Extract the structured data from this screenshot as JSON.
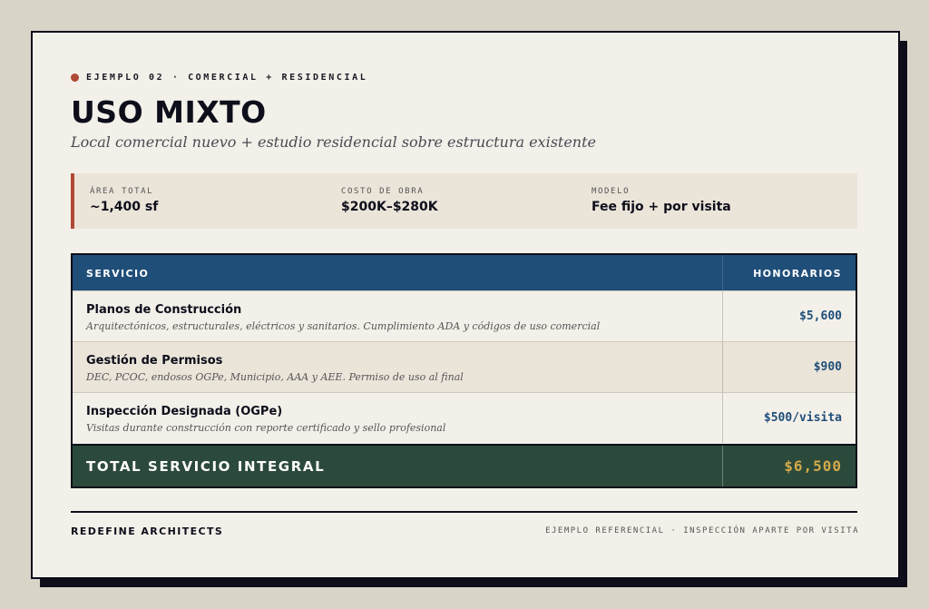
{
  "eyebrow": "EJEMPLO 02 · COMERCIAL + RESIDENCIAL",
  "title": "USO MIXTO",
  "subtitle": "Local comercial nuevo + estudio residencial sobre estructura existente",
  "stats": [
    {
      "label": "ÁREA TOTAL",
      "value": "~1,400 sf"
    },
    {
      "label": "COSTO DE OBRA",
      "value": "$200K–$280K"
    },
    {
      "label": "MODELO",
      "value": "Fee fijo + por visita"
    }
  ],
  "table": {
    "header_service": "SERVICIO",
    "header_fees": "HONORARIOS",
    "rows": [
      {
        "name": "Planos de Construcción",
        "desc": "Arquitectónicos, estructurales, eléctricos y sanitarios. Cumplimiento ADA y códigos de uso comercial",
        "fee": "$5,600"
      },
      {
        "name": "Gestión de Permisos",
        "desc": "DEC, PCOC, endosos OGPe, Municipio, AAA y AEE. Permiso de uso al final",
        "fee": "$900"
      },
      {
        "name": "Inspección Designada (OGPe)",
        "desc": "Visitas durante construcción con reporte certificado y sello profesional",
        "fee": "$500/visita"
      }
    ],
    "total_label": "TOTAL SERVICIO INTEGRAL",
    "total_value": "$6,500"
  },
  "footer": {
    "brand": "REDEFINE ARCHITECTS",
    "note": "EJEMPLO REFERENCIAL · INSPECCIÓN APARTE POR VISITA"
  },
  "colors": {
    "accent": "#b04a34",
    "header": "#1f4e79",
    "total_bg": "#2b4a3b",
    "total_value": "#d4a94a"
  }
}
